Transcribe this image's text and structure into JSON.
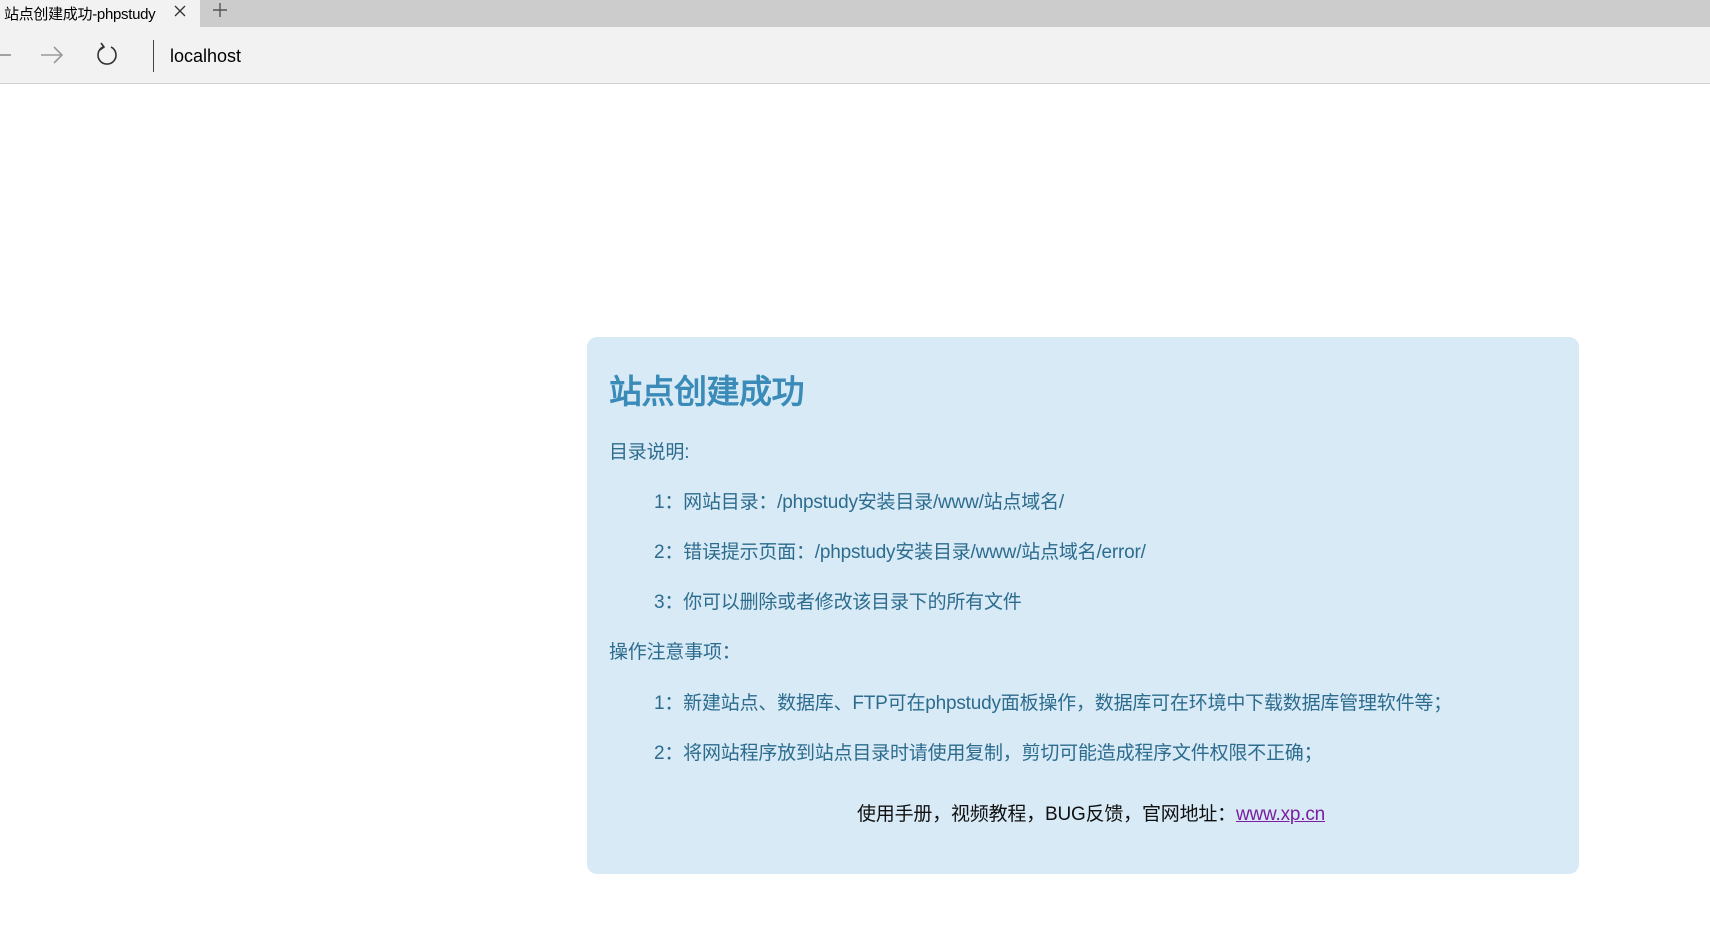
{
  "browser": {
    "tab": {
      "title": "站点创建成功-phpstudy"
    },
    "address": "localhost"
  },
  "page": {
    "title": "站点创建成功",
    "dir_section": {
      "label": "目录说明:",
      "items": [
        "1：网站目录：/phpstudy安装目录/www/站点域名/",
        "2：错误提示页面：/phpstudy安装目录/www/站点域名/error/",
        "3：你可以删除或者修改该目录下的所有文件"
      ]
    },
    "notes_section": {
      "label": "操作注意事项：",
      "items": [
        "1：新建站点、数据库、FTP可在phpstudy面板操作，数据库可在环境中下载数据库管理软件等；",
        "2：将网站程序放到站点目录时请使用复制，剪切可能造成程序文件权限不正确；"
      ]
    },
    "footer": {
      "text": "使用手册，视频教程，BUG反馈，官网地址：",
      "link": "www.xp.cn"
    }
  },
  "colors": {
    "card_bg": "#d7eaf5",
    "title": "#3b8bb8",
    "body_text": "#2d6c8f",
    "link": "#7a1fa0"
  },
  "icons": [
    "close-icon",
    "plus-icon",
    "back-arrow-icon",
    "forward-arrow-icon",
    "refresh-icon"
  ]
}
